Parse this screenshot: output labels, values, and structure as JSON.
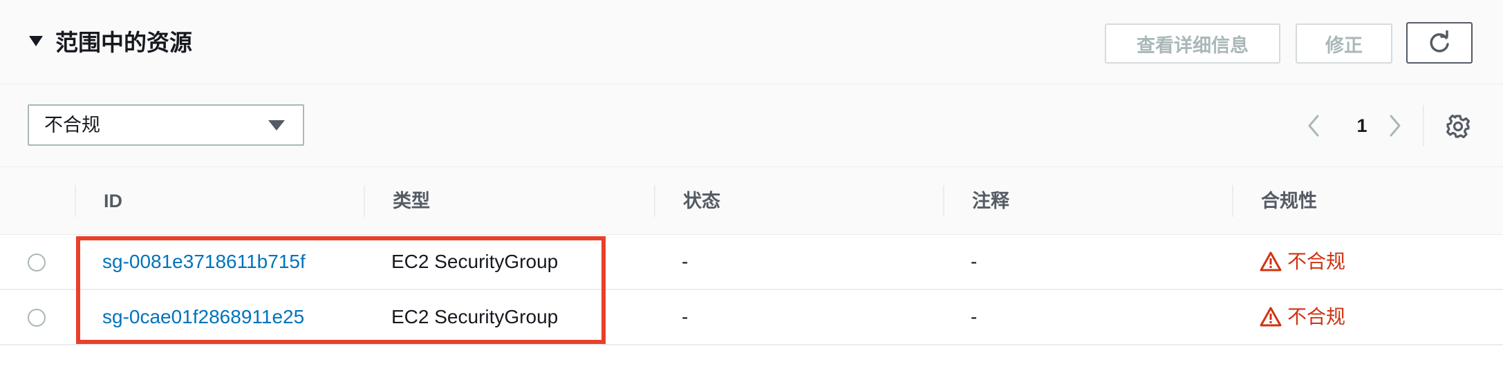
{
  "header": {
    "title": "范围中的资源",
    "details_button": "查看详细信息",
    "fix_button": "修正"
  },
  "filter": {
    "selected": "不合规"
  },
  "pagination": {
    "current_page": "1"
  },
  "table": {
    "columns": [
      "ID",
      "类型",
      "状态",
      "注释",
      "合规性"
    ],
    "rows": [
      {
        "id": "sg-0081e3718611b715f",
        "type": "EC2 SecurityGroup",
        "status": "-",
        "note": "-",
        "compliance": "不合规"
      },
      {
        "id": "sg-0cae01f2868911e25",
        "type": "EC2 SecurityGroup",
        "status": "-",
        "note": "-",
        "compliance": "不合规"
      }
    ]
  },
  "colors": {
    "link": "#0073bb",
    "noncompliant": "#d13212",
    "highlight": "#e8402a"
  },
  "icons": {
    "refresh": "refresh-icon",
    "prev": "chevron-left-icon",
    "next": "chevron-right-icon",
    "settings": "gear-icon",
    "warning": "warning-icon",
    "collapse": "caret-down-icon"
  }
}
